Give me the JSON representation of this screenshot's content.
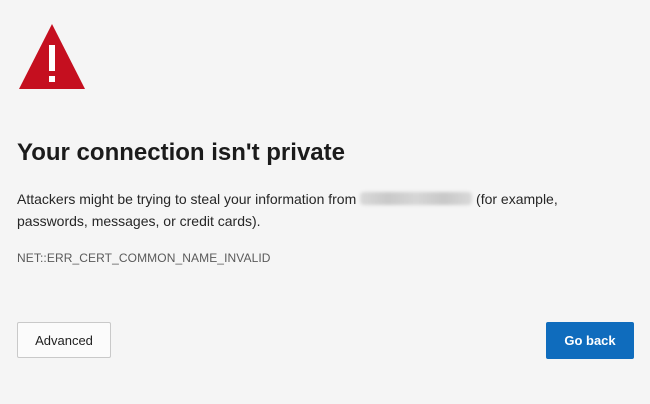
{
  "colors": {
    "warning_red": "#c50f1f",
    "primary_blue": "#0f6cbd",
    "background": "#f5f5f5"
  },
  "icons": {
    "warning": "warning-triangle-icon"
  },
  "error": {
    "title": "Your connection isn't private",
    "message_before": "Attackers might be trying to steal your information from",
    "message_after": "(for example, passwords, messages, or credit cards).",
    "code": "NET::ERR_CERT_COMMON_NAME_INVALID"
  },
  "buttons": {
    "advanced_label": "Advanced",
    "go_back_label": "Go back"
  }
}
